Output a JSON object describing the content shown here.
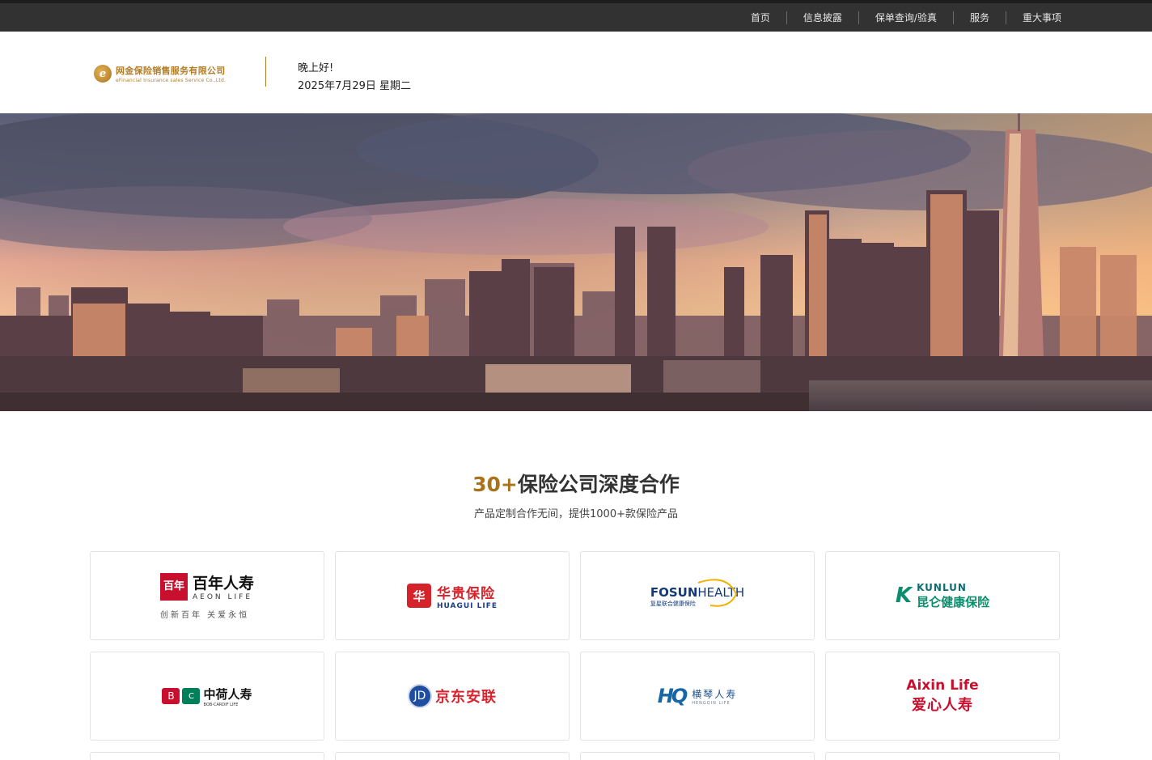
{
  "topnav": {
    "items": [
      {
        "label": "首页"
      },
      {
        "label": "信息披露"
      },
      {
        "label": "保单查询/验真"
      },
      {
        "label": "服务"
      },
      {
        "label": "重大事项"
      }
    ]
  },
  "header": {
    "logo_cn": "网金保险销售服务有限公司",
    "logo_en": "eFinancial Insurance sales Service Co.,Ltd.",
    "logo_mark": "e",
    "greeting": "晚上好!",
    "date": "2025年7月29日 星期二"
  },
  "partners": {
    "title_accent": "30+",
    "title_rest": "保险公司深度合作",
    "subtitle": "产品定制合作无间，提供1000+款保险产品",
    "cards": [
      {
        "name": "aeon",
        "box": "百年",
        "cn": "百年人寿",
        "en": "AEON LIFE",
        "tag": "创新百年  关爱永恒"
      },
      {
        "name": "huagui",
        "box": "华",
        "cn": "华贵保险",
        "en": "HUAGUI LIFE"
      },
      {
        "name": "fosun",
        "a": "FOSUN",
        "b": "HEALTH",
        "sub": "复星联合健康保险"
      },
      {
        "name": "kunlun",
        "mark": "K",
        "en": "KUNLUN",
        "cn": "昆仑健康保险"
      },
      {
        "name": "bob",
        "icon1": "B",
        "icon2": "C",
        "cn": "中荷人寿",
        "en": "BOB-CARDIF LIFE"
      },
      {
        "name": "jd",
        "icon": "JD",
        "cn": "京东安联"
      },
      {
        "name": "hengqin",
        "mark": "HQ",
        "cn": "横琴人寿",
        "en": "HENGQIN LIFE"
      },
      {
        "name": "aixin",
        "en": "Aixin Life",
        "cn": "爱心人寿"
      }
    ]
  },
  "colors": {
    "topbar": "#323232",
    "accent_gold": "#a8731d",
    "brand_red": "#c8102e"
  }
}
